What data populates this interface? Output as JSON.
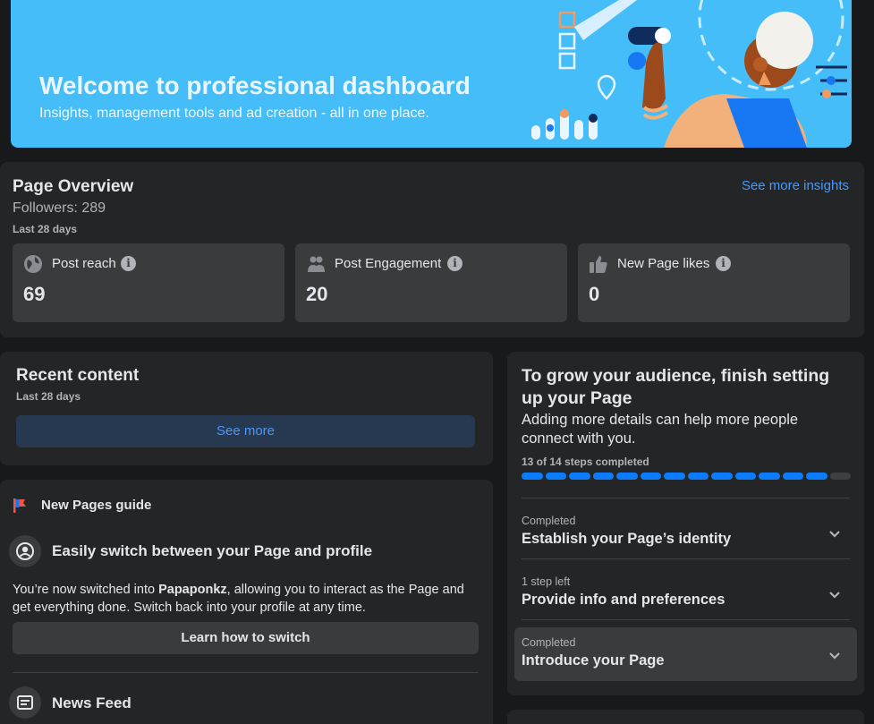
{
  "banner": {
    "title": "Welcome to professional dashboard",
    "subtitle": "Insights, management tools and ad creation - all in one place."
  },
  "overview": {
    "title": "Page Overview",
    "followers": "Followers: 289",
    "period": "Last 28 days",
    "see_more": "See more insights",
    "metrics": [
      {
        "icon": "globe-icon",
        "label": "Post reach",
        "value": "69"
      },
      {
        "icon": "people-icon",
        "label": "Post Engagement",
        "value": "20"
      },
      {
        "icon": "thumbs-up-icon",
        "label": "New Page likes",
        "value": "0"
      }
    ]
  },
  "recent": {
    "title": "Recent content",
    "period": "Last 28 days",
    "button": "See more"
  },
  "guide": {
    "header": "New Pages guide",
    "switch_title": "Easily switch between your Page and profile",
    "text_before": "You’re now switched into ",
    "page_name": "Papaponkz",
    "text_after": ", allowing you to interact as the Page and get everything done. Switch back into your profile at any time.",
    "button": "Learn how to switch",
    "news_feed": "News Feed"
  },
  "setup": {
    "title": "To grow your audience, finish setting up your Page",
    "description": "Adding more details can help more people connect with you.",
    "steps_text": "13 of 14 steps completed",
    "steps_completed": 13,
    "steps_total": 14,
    "rows": [
      {
        "status": "Completed",
        "label": "Establish your Page’s identity"
      },
      {
        "status": "1 step left",
        "label": "Provide info and preferences"
      },
      {
        "status": "Completed",
        "label": "Introduce your Page"
      }
    ]
  },
  "colors": {
    "banner": "#45bdf9",
    "accent": "#0a7cff",
    "link": "#4599ff",
    "card": "#242526",
    "background": "#18191a"
  }
}
